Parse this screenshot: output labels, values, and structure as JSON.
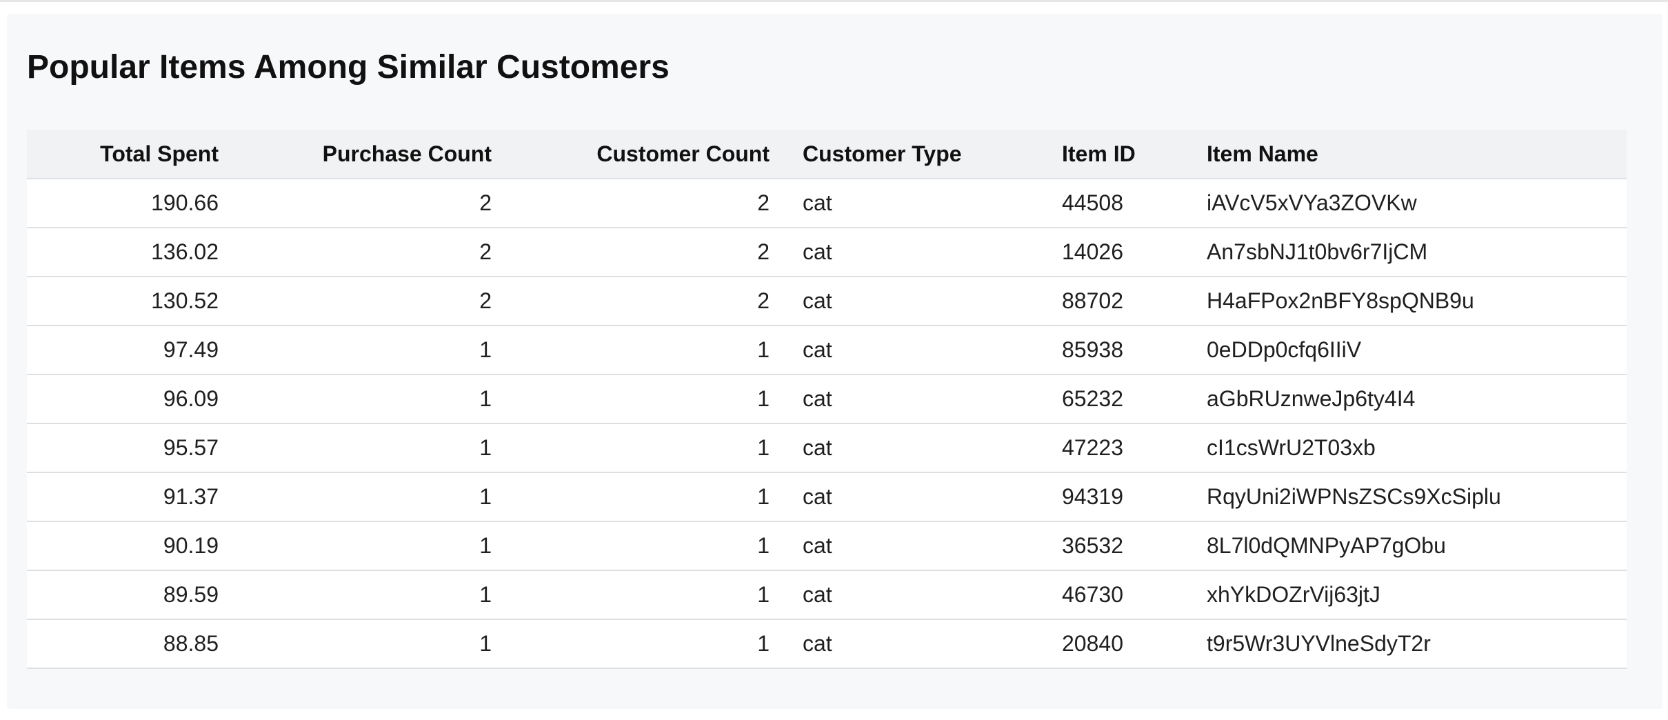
{
  "page": {
    "title": "Popular Items Among Similar Customers"
  },
  "table": {
    "columns": [
      "Total Spent",
      "Purchase Count",
      "Customer Count",
      "Customer Type",
      "Item ID",
      "Item Name"
    ],
    "rows": [
      [
        "190.66",
        "2",
        "2",
        "cat",
        "44508",
        "iAVcV5xVYa3ZOVKw"
      ],
      [
        "136.02",
        "2",
        "2",
        "cat",
        "14026",
        "An7sbNJ1t0bv6r7IjCM"
      ],
      [
        "130.52",
        "2",
        "2",
        "cat",
        "88702",
        "H4aFPox2nBFY8spQNB9u"
      ],
      [
        "97.49",
        "1",
        "1",
        "cat",
        "85938",
        "0eDDp0cfq6IIiV"
      ],
      [
        "96.09",
        "1",
        "1",
        "cat",
        "65232",
        "aGbRUznweJp6ty4I4"
      ],
      [
        "95.57",
        "1",
        "1",
        "cat",
        "47223",
        "cI1csWrU2T03xb"
      ],
      [
        "91.37",
        "1",
        "1",
        "cat",
        "94319",
        "RqyUni2iWPNsZSCs9XcSiplu"
      ],
      [
        "90.19",
        "1",
        "1",
        "cat",
        "36532",
        "8L7l0dQMNPyAP7gObu"
      ],
      [
        "89.59",
        "1",
        "1",
        "cat",
        "46730",
        "xhYkDOZrVij63jtJ"
      ],
      [
        "88.85",
        "1",
        "1",
        "cat",
        "20840",
        "t9r5Wr3UYVlneSdyT2r"
      ]
    ]
  },
  "colors": {
    "panel_background": "#f7f8fa",
    "header_background": "#f1f2f4",
    "row_background": "#ffffff",
    "row_border": "#dddfe3"
  }
}
